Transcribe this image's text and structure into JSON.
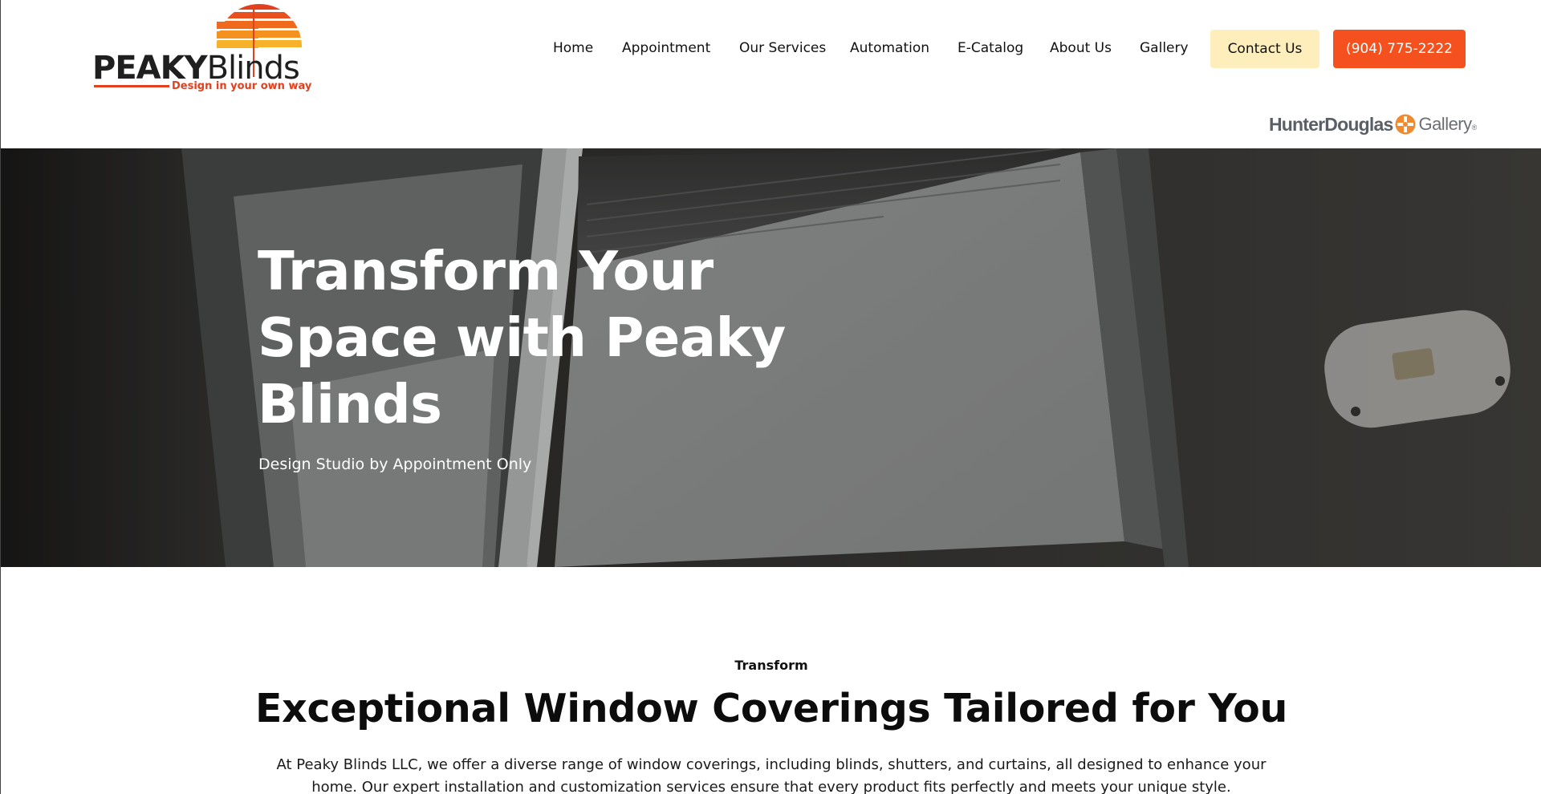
{
  "brand": {
    "name_bold": "PEAKY",
    "name_light": "Blinds",
    "tagline": "Design in your own way",
    "accent": "#e2401f",
    "stripe_colors": [
      "#e2401f",
      "#ef6a1c",
      "#f4911f",
      "#f7b22a"
    ]
  },
  "nav": {
    "items": [
      {
        "label": "Home"
      },
      {
        "label": "Appointment"
      },
      {
        "label": "Our Services"
      },
      {
        "label": "Automation"
      },
      {
        "label": "E-Catalog"
      },
      {
        "label": "About Us"
      },
      {
        "label": "Gallery"
      }
    ],
    "contact_label": "Contact Us",
    "phone_label": "(904) 775-2222",
    "contact_color": "#fdeebc",
    "phone_color": "#f4511e"
  },
  "partner": {
    "name": "HunterDouglas",
    "suffix": "Gallery",
    "trademark": "®",
    "mark_color": "#f08a2e"
  },
  "hero": {
    "title": "Transform Your Space with Peaky Blinds",
    "subtitle": "Design Studio by Appointment Only"
  },
  "intro": {
    "eyebrow": "Transform",
    "title": "Exceptional Window Coverings Tailored for You",
    "body": "At Peaky Blinds LLC, we offer a diverse range of window coverings, including blinds, shutters, and curtains, all designed to enhance your home. Our expert installation and customization services ensure that every product fits perfectly and meets your unique style."
  }
}
